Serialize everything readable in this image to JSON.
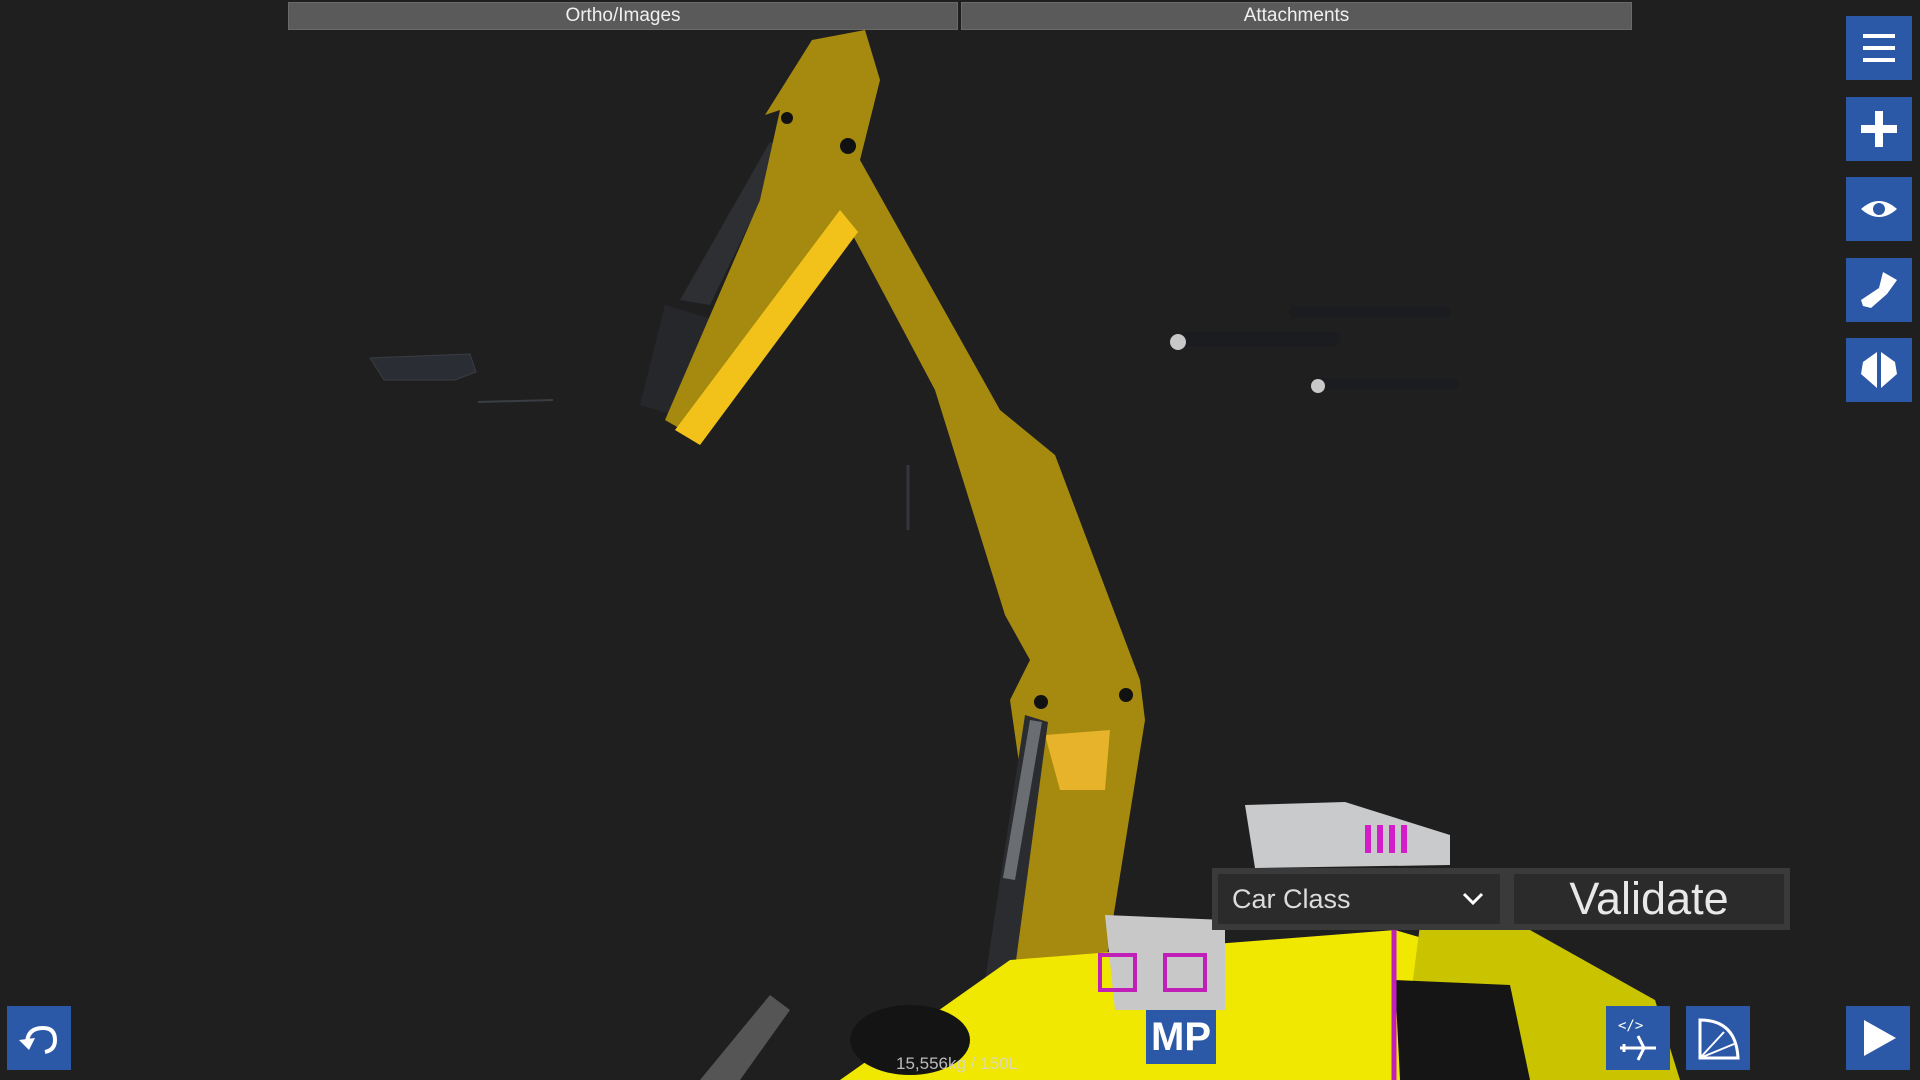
{
  "tabs": {
    "ortho_label": "Ortho/Images",
    "attachments_label": "Attachments"
  },
  "sidebar": {
    "buttons": [
      {
        "icon": "menu-icon"
      },
      {
        "icon": "add-part-icon"
      },
      {
        "icon": "view-eye-icon"
      },
      {
        "icon": "paint-brush-icon"
      },
      {
        "icon": "symmetry-icon"
      }
    ]
  },
  "validation": {
    "class_selected": "Car Class",
    "validate_label": "Validate"
  },
  "status": {
    "mass_text": "15,556kg / 150L"
  },
  "bottom": {
    "mp_label": "MP"
  },
  "colors": {
    "accent_blue": "#2c58a8",
    "part_yellow": "#a58a0f",
    "bright_yellow": "#f0e800",
    "magenta": "#d020c0"
  }
}
